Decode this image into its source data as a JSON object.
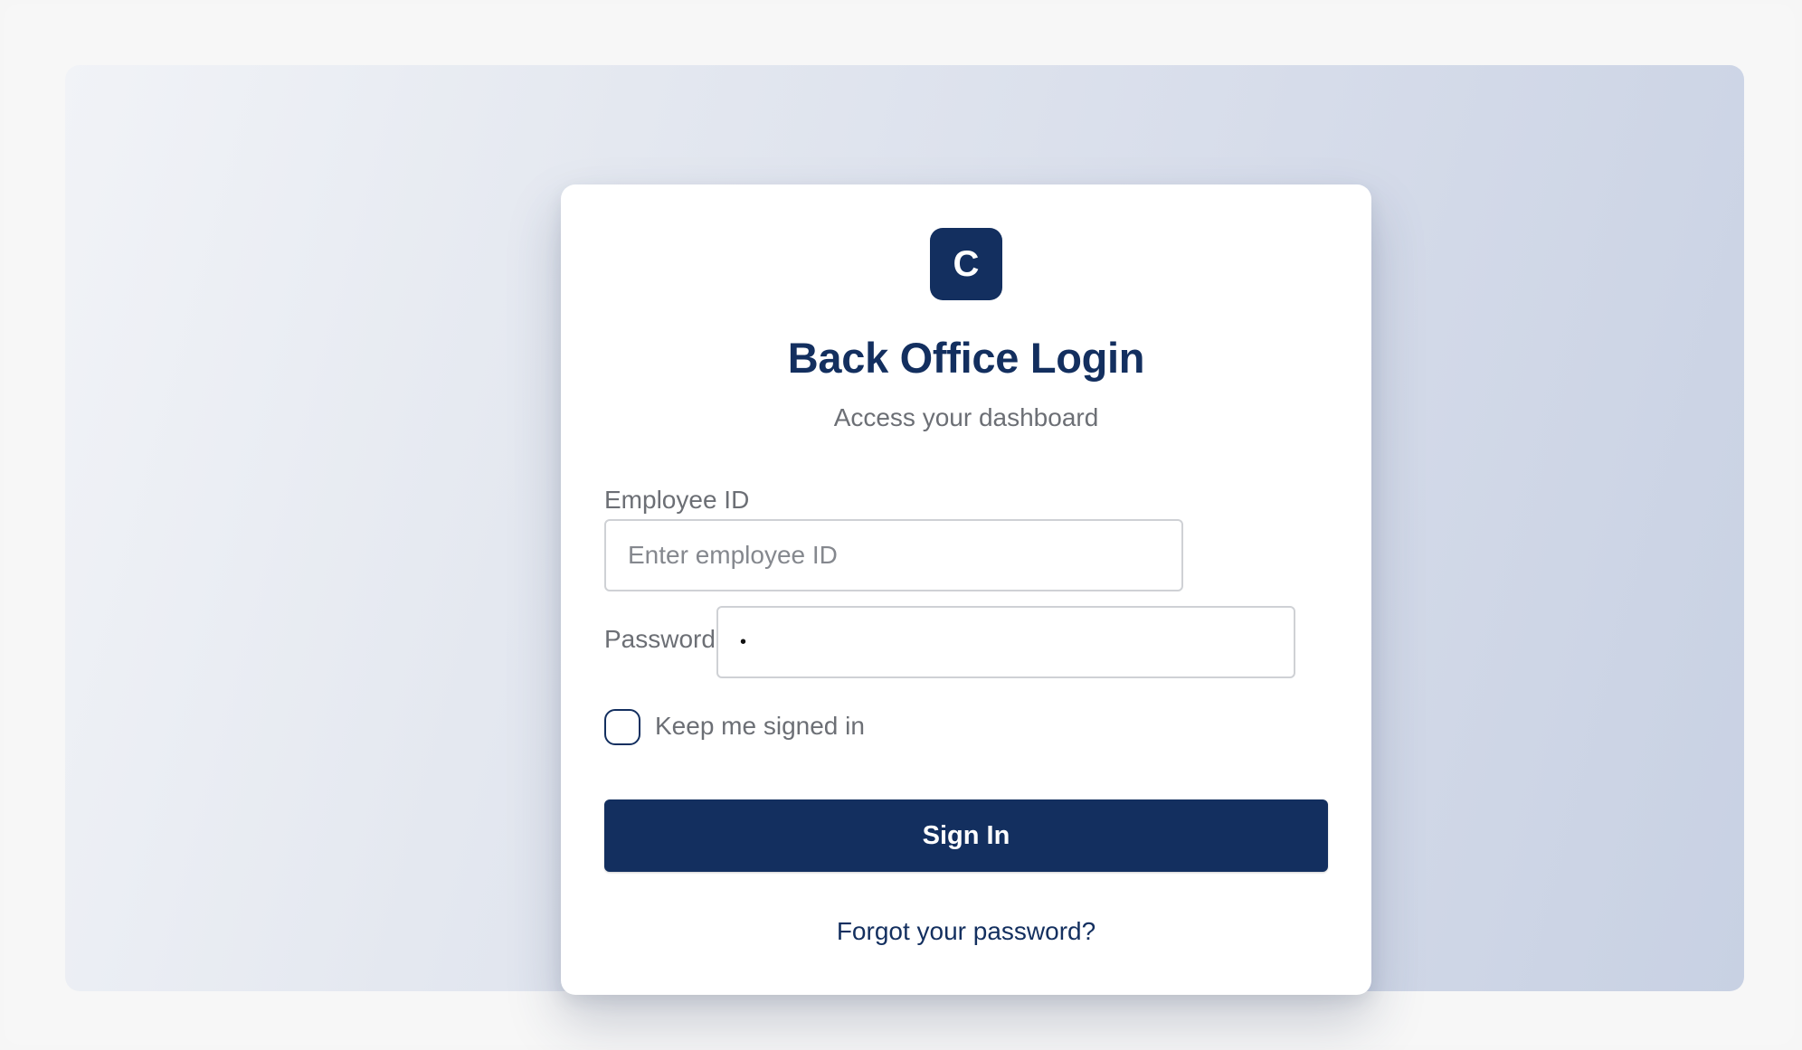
{
  "login": {
    "logo_letter": "C",
    "title": "Back Office Login",
    "subtitle": "Access your dashboard",
    "employee_id": {
      "label": "Employee ID",
      "placeholder": "Enter employee ID",
      "value": ""
    },
    "password": {
      "label": "Password",
      "value": "•"
    },
    "keep_signed_in": {
      "label": "Keep me signed in",
      "checked": false
    },
    "sign_in_label": "Sign In",
    "forgot_link": "Forgot your password?"
  },
  "colors": {
    "brand": "#132f5f",
    "muted_text": "#6c6f75",
    "input_border": "#cfd1d5",
    "card_bg": "#ffffff"
  }
}
